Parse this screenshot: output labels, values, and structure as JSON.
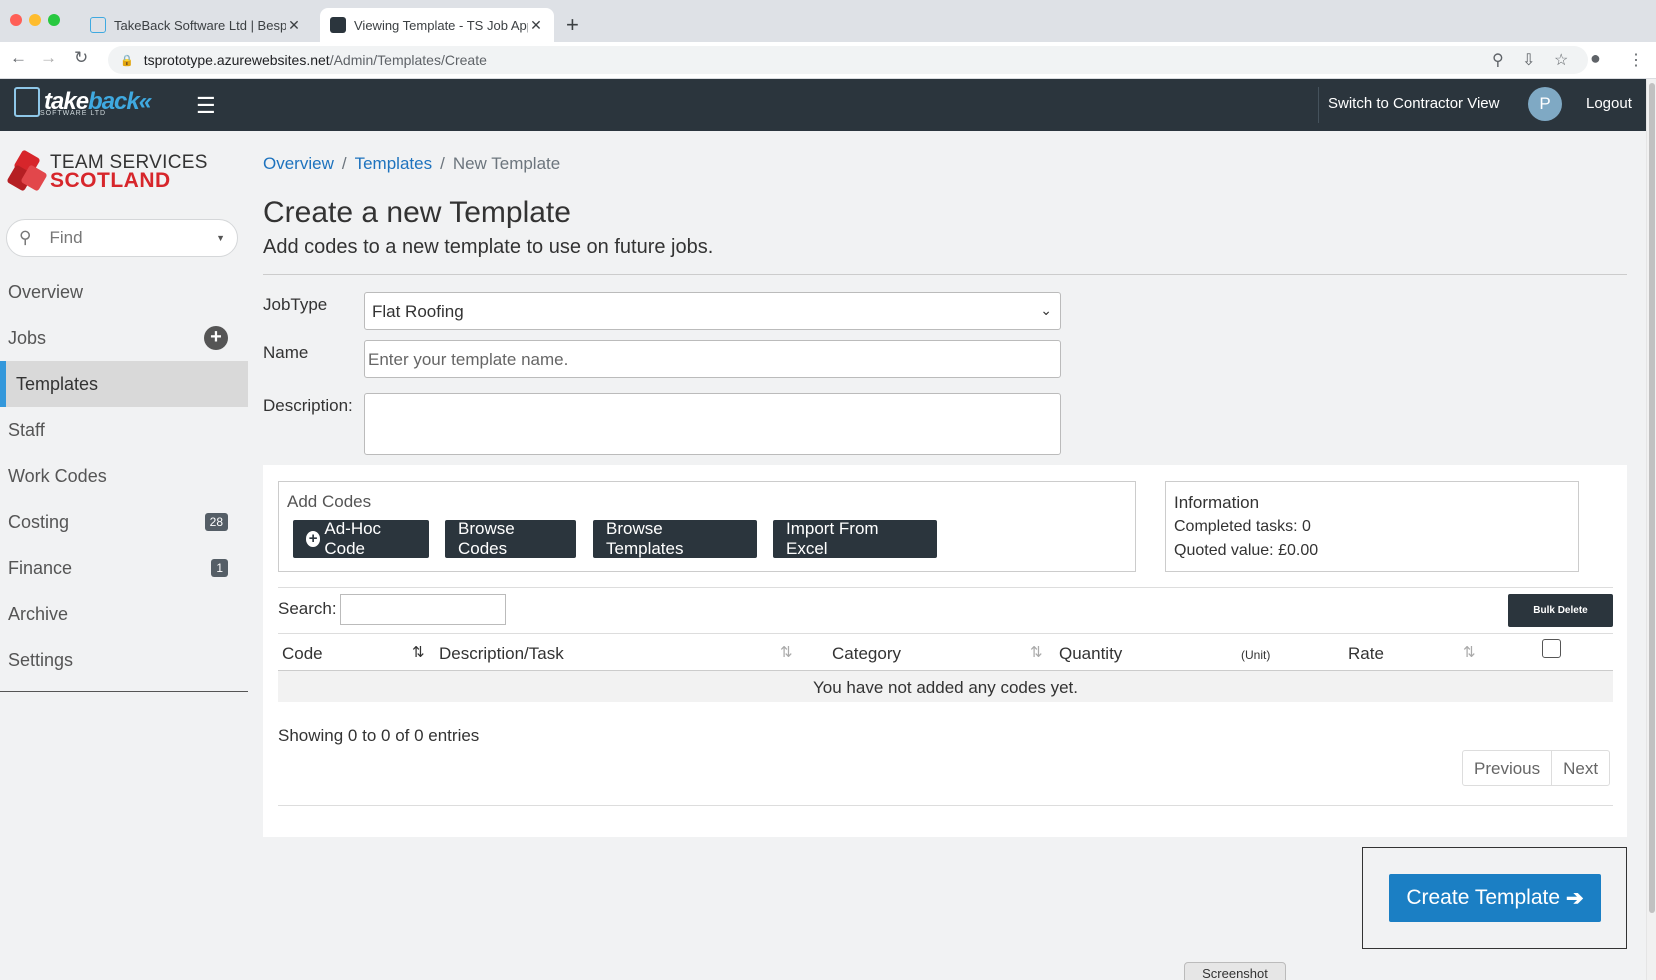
{
  "browser": {
    "tabs": [
      {
        "title": "TakeBack Software Ltd | Bespo",
        "active": false
      },
      {
        "title": "Viewing Template - TS Job App",
        "active": true
      }
    ],
    "url_host": "tsprototype.azurewebsites.net",
    "url_path": "/Admin/Templates/Create"
  },
  "header": {
    "logo_main": "take",
    "logo_accent": "back",
    "logo_sub": "SOFTWARE LTD",
    "switch_view": "Switch to Contractor View",
    "avatar_initial": "P",
    "logout": "Logout"
  },
  "sidebar": {
    "brand_line1": "TEAM SERVICES",
    "brand_line2": "SCOTLAND",
    "find_placeholder": "Find",
    "items": [
      {
        "label": "Overview"
      },
      {
        "label": "Jobs"
      },
      {
        "label": "Templates"
      },
      {
        "label": "Staff"
      },
      {
        "label": "Work Codes"
      },
      {
        "label": "Costing",
        "badge": "28"
      },
      {
        "label": "Finance",
        "badge": "1"
      },
      {
        "label": "Archive"
      },
      {
        "label": "Settings"
      }
    ]
  },
  "breadcrumb": [
    "Overview",
    "Templates",
    "New Template"
  ],
  "page": {
    "title": "Create a new Template",
    "subtitle": "Add codes to a new template to use on future jobs."
  },
  "form": {
    "jobtype_label": "JobType",
    "jobtype_value": "Flat Roofing",
    "name_label": "Name",
    "name_placeholder": "Enter your template name.",
    "description_label": "Description:"
  },
  "codes": {
    "legend": "Add Codes",
    "buttons": [
      "Ad-Hoc Code",
      "Browse Codes",
      "Browse Templates",
      "Import From Excel"
    ]
  },
  "info": {
    "title": "Information",
    "completed": "Completed tasks: 0",
    "quoted": "Quoted value: £0.00"
  },
  "table": {
    "search_label": "Search:",
    "bulk_delete": "Bulk Delete",
    "columns": [
      "Code",
      "Description/Task",
      "Category",
      "Quantity",
      "(Unit)",
      "Rate"
    ],
    "empty": "You have not added any codes yet.",
    "showing": "Showing 0 to 0 of 0 entries",
    "prev": "Previous",
    "next": "Next"
  },
  "actions": {
    "create": "Create Template"
  },
  "screenshot_label": "Screenshot",
  "colors": {
    "header_bg": "#2b353d",
    "accent_blue": "#1b7fc4",
    "brand_red": "#d7262b",
    "link_blue": "#1e73be"
  }
}
